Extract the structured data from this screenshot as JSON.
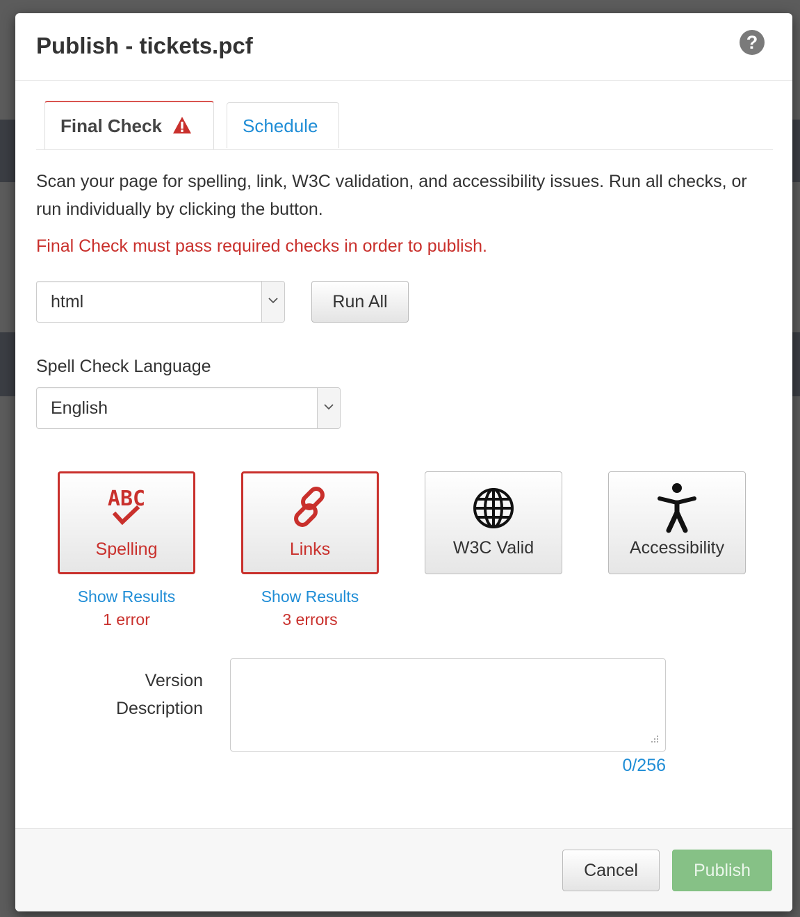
{
  "modal": {
    "title": "Publish - tickets.pcf"
  },
  "tabs": [
    {
      "label": "Final Check",
      "active": true,
      "status": "warning"
    },
    {
      "label": "Schedule",
      "active": false
    }
  ],
  "final_check": {
    "intro": "Scan your page for spelling, link, W3C validation, and accessibility issues. Run all checks, or run individually by clicking the button.",
    "requirement_text": "Final Check must pass required checks in order to publish.",
    "output_select": {
      "value": "html"
    },
    "run_all_label": "Run All",
    "language_label": "Spell Check Language",
    "language_select": {
      "value": "English"
    },
    "checks": [
      {
        "label": "Spelling",
        "icon": "abc-check-icon",
        "status": "error",
        "results_link": "Show Results",
        "result_count": "1 error"
      },
      {
        "label": "Links",
        "icon": "link-icon",
        "status": "error",
        "results_link": "Show Results",
        "result_count": "3 errors"
      },
      {
        "label": "W3C Valid",
        "icon": "globe-icon",
        "status": "unchecked"
      },
      {
        "label": "Accessibility",
        "icon": "accessibility-icon",
        "status": "unchecked"
      }
    ],
    "version_description": {
      "label_line1": "Version",
      "label_line2": "Description",
      "value": "",
      "char_count": "0/256"
    }
  },
  "footer": {
    "cancel_label": "Cancel",
    "publish_label": "Publish",
    "publish_enabled": false
  },
  "colors": {
    "error": "#c9302c",
    "link": "#1f8dd6",
    "publish_disabled": "#86c186"
  }
}
